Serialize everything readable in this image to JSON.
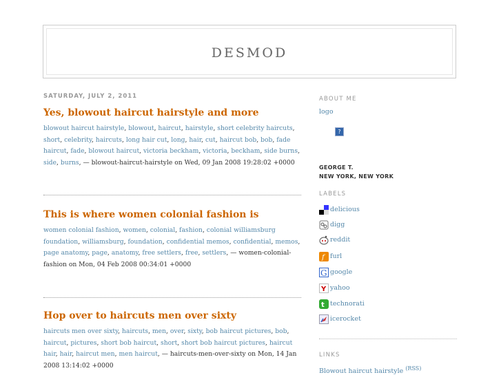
{
  "header": {
    "title": "DESMOD"
  },
  "main": {
    "date": "SATURDAY, JULY 2, 2011",
    "posts": [
      {
        "title": "Yes, blowout haircut hairstyle and more",
        "tags": [
          "blowout haircut hairstyle",
          "blowout",
          "haircut",
          "hairstyle",
          "short celebrity haircuts",
          "short",
          "celebrity",
          "haircuts",
          "long hair cut",
          "long",
          "hair",
          "cut",
          "haircut bob",
          "bob",
          "fade haircut",
          "fade",
          "blowout haircut",
          "victoria beckham",
          "victoria",
          "beckham",
          "side burns",
          "side",
          "burns"
        ],
        "tail": ", — blowout-haircut-hairstyle on Wed, 09 Jan 2008 19:28:02 +0000"
      },
      {
        "title": "This is where women colonial fashion is",
        "tags": [
          "women colonial fashion",
          "women",
          "colonial",
          "fashion",
          "colonial williamsburg foundation",
          "williamsburg",
          "foundation",
          "confidential memos",
          "confidential",
          "memos",
          "page anatomy",
          "page",
          "anatomy",
          "free settlers",
          "free",
          "settlers"
        ],
        "tail": ", — women-colonial-fashion on Mon, 04 Feb 2008 00:34:01 +0000"
      },
      {
        "title": "Hop over to haircuts men over sixty",
        "tags": [
          "haircuts men over sixty",
          "haircuts",
          "men",
          "over",
          "sixty",
          "bob haircut pictures",
          "bob",
          "haircut",
          "pictures",
          "short bob haircut",
          "short",
          "short bob haircut pictures",
          "haircut hair",
          "hair",
          "haircut men",
          "men haircut"
        ],
        "tail": ", — haircuts-men-over-sixty on Mon, 14 Jan 2008 13:14:02 +0000"
      }
    ]
  },
  "sidebar": {
    "about_heading": "ABOUT ME",
    "logo_link": "logo",
    "qmark": "?",
    "author_name": "GEORGE T.",
    "author_location": "NEW YORK, NEW YORK",
    "labels_heading": "LABELS",
    "labels": [
      {
        "text": "delicious",
        "icon": "delicious-icon"
      },
      {
        "text": "digg",
        "icon": "digg-icon"
      },
      {
        "text": "reddit",
        "icon": "reddit-icon"
      },
      {
        "text": "furl",
        "icon": "furl-icon"
      },
      {
        "text": "google",
        "icon": "google-icon"
      },
      {
        "text": "yahoo",
        "icon": "yahoo-icon"
      },
      {
        "text": "technorati",
        "icon": "technorati-icon"
      },
      {
        "text": "icerocket",
        "icon": "icerocket-icon"
      }
    ],
    "links_heading": "LINKS",
    "links": [
      {
        "text": "Blowout haircut hairstyle",
        "rss": "(RSS)"
      }
    ]
  },
  "colors": {
    "title_orange": "#cc6600",
    "link_blue": "#5588aa",
    "muted_gray": "#999999"
  }
}
